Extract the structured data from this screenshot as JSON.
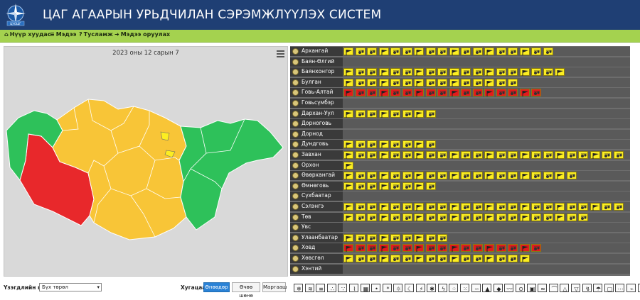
{
  "app": {
    "title": "ЦАГ АГААРЫН УРЬДЧИЛАН СЭРЭМЖЛҮҮЛЭХ СИСТЕМ",
    "logo_icon": "compass-logo"
  },
  "nav": [
    {
      "label": "Нүүр хуудас",
      "icon": "home-icon",
      "glyph": "⌂"
    },
    {
      "label": "Мэдээ",
      "icon": "list-icon",
      "glyph": "≡"
    },
    {
      "label": "Тусламж",
      "icon": "help-icon",
      "glyph": "?"
    },
    {
      "label": "Мэдээ оруулах",
      "icon": "login-icon",
      "glyph": "➜"
    }
  ],
  "map": {
    "date": "2023 оны 12 сарын 7",
    "colors": {
      "red": "#e8282b",
      "yellow": "#f8c537",
      "green": "#2ec15a",
      "border": "#ffffff",
      "bg": "#d9d9d9"
    }
  },
  "colors": {
    "yellow": "#fcee21",
    "red": "#e41a1c",
    "row_bg": "#5a5a5a",
    "name_bg": "#3a3a3a"
  },
  "aimags": [
    {
      "name": "Архангай",
      "status": "yellow",
      "count": 18
    },
    {
      "name": "Баян-Өлгий",
      "status": "none",
      "count": 0
    },
    {
      "name": "Баянхонгор",
      "status": "yellow",
      "count": 19
    },
    {
      "name": "Булган",
      "status": "yellow",
      "count": 15
    },
    {
      "name": "Говь-Алтай",
      "status": "red",
      "count": 17
    },
    {
      "name": "Говьсүмбэр",
      "status": "none",
      "count": 0
    },
    {
      "name": "Дархан-Уул",
      "status": "yellow",
      "count": 8
    },
    {
      "name": "Дорноговь",
      "status": "none",
      "count": 0
    },
    {
      "name": "Дорнод",
      "status": "none",
      "count": 0
    },
    {
      "name": "Дундговь",
      "status": "yellow",
      "count": 8
    },
    {
      "name": "Завхан",
      "status": "yellow",
      "count": 24
    },
    {
      "name": "Орхон",
      "status": "yellow",
      "count": 1
    },
    {
      "name": "Өвөрхангай",
      "status": "yellow",
      "count": 20
    },
    {
      "name": "Өмнөговь",
      "status": "yellow",
      "count": 8
    },
    {
      "name": "Сүхбаатар",
      "status": "none",
      "count": 0
    },
    {
      "name": "Сэлэнгэ",
      "status": "yellow",
      "count": 24
    },
    {
      "name": "Төв",
      "status": "yellow",
      "count": 21
    },
    {
      "name": "Увс",
      "status": "none",
      "count": 0
    },
    {
      "name": "Улаанбаатар",
      "status": "yellow",
      "count": 9
    },
    {
      "name": "Ховд",
      "status": "red",
      "count": 17
    },
    {
      "name": "Хөвсгөл",
      "status": "yellow",
      "count": 16
    },
    {
      "name": "Хэнтий",
      "status": "none",
      "count": 0
    }
  ],
  "filter": {
    "label": "Үзэгдлийн нэр:",
    "selected": "Бүх төрөл"
  },
  "time": {
    "label": "Хугацаа:",
    "buttons": [
      {
        "label": "Өнөөдөр",
        "active": true
      },
      {
        "label": "Өчөө шөнө",
        "active": false
      },
      {
        "label": "Маргааш",
        "active": false
      }
    ]
  },
  "legend_icons": [
    "snow-icon",
    "wind-icon",
    "fog-icon",
    "dust-icon",
    "rain-icon",
    "ice-icon",
    "flood-icon",
    "hail-icon",
    "frost-icon",
    "heat-icon",
    "cold-icon",
    "storm-icon",
    "blizzard-icon",
    "thunder-icon",
    "drizzle-icon",
    "sleet-icon",
    "mist-icon",
    "smoke-icon",
    "haze-icon",
    "squall-icon",
    "tornado-icon",
    "fire-icon",
    "drought-icon",
    "wave-icon",
    "avalanche-icon",
    "mudflow-icon",
    "gust-icon",
    "shower-icon",
    "whiteout-icon",
    "dew-icon",
    "glaze-icon",
    "cloud-icon"
  ]
}
